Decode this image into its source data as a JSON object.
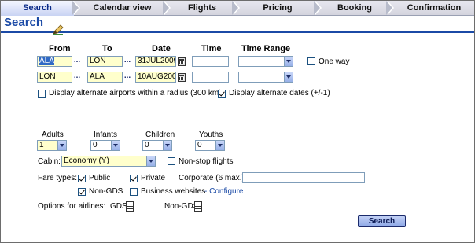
{
  "steps": [
    "Search",
    "Calendar view",
    "Flights",
    "Pricing",
    "Booking",
    "Confirmation"
  ],
  "title": "Search",
  "headers": {
    "from": "From",
    "to": "To",
    "date": "Date",
    "time": "Time",
    "time_range": "Time Range"
  },
  "flights": [
    {
      "from": "ALA",
      "to": "LON",
      "date": "31JUL2009",
      "time": "",
      "time_range": ""
    },
    {
      "from": "LON",
      "to": "ALA",
      "date": "10AUG2009",
      "time": "",
      "time_range": ""
    }
  ],
  "dots_label": "...",
  "one_way_label": "One way",
  "alt_airports_label": "Display alternate airports within a radius (300 km)",
  "alt_dates_label": "Display alternate dates (+/-1)",
  "passengers": {
    "adults_label": "Adults",
    "adults_value": "1",
    "infants_label": "Infants",
    "infants_value": "0",
    "children_label": "Children",
    "children_value": "0",
    "youths_label": "Youths",
    "youths_value": "0"
  },
  "cabin": {
    "label": "Cabin:",
    "value": "Economy (Y)",
    "nonstop_label": "Non-stop flights"
  },
  "fare_types": {
    "label": "Fare types:",
    "public_label": "Public",
    "private_label": "Private",
    "corporate_label": "Corporate (6 max.):",
    "corporate_value": "",
    "non_gds_label": "Non-GDS",
    "business_websites_label": "Business websites",
    "configure_label": "- Configure"
  },
  "airlines": {
    "label": "Options for airlines:",
    "gds_label": "GDS",
    "non_gds_label": "Non-GDS"
  },
  "search_button": "Search",
  "colors": {
    "accent": "#1b4aa6",
    "field_highlight": "#ffffcc",
    "selection": "#316ac5"
  },
  "icons": [
    "pen-icon",
    "calendar-icon",
    "dropdown-arrow-icon",
    "list-icon",
    "check-icon"
  ]
}
